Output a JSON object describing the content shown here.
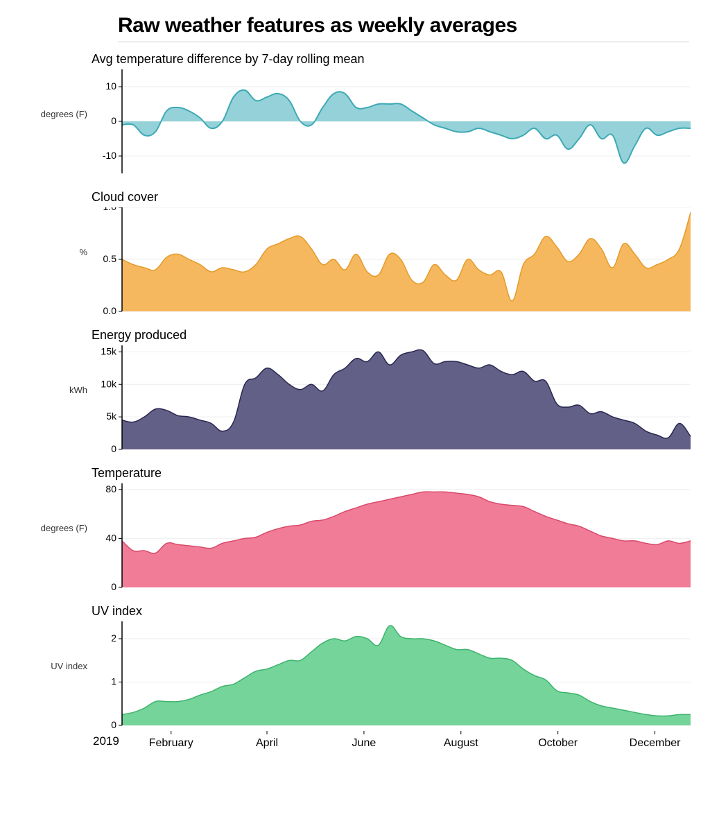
{
  "title": "Raw weather features as weekly averages",
  "x_start_label": "2019",
  "months": [
    "February",
    "April",
    "June",
    "August",
    "October",
    "December"
  ],
  "panels": [
    {
      "id": "tempdiff",
      "title": "Avg temperature difference by 7-day rolling mean",
      "ylabel": "degrees (F)",
      "ymin": -15,
      "ymax": 15,
      "yticks": [
        -10,
        0,
        10
      ],
      "baseline": 0,
      "fill": "#8ecfd6",
      "stroke": "#3da9b5",
      "stroke_w": 2
    },
    {
      "id": "cloud",
      "title": "Cloud cover",
      "ylabel": "%",
      "ymin": 0,
      "ymax": 1,
      "yticks": [
        0.0,
        0.5,
        1.0
      ],
      "tick_dec": 1,
      "baseline": 0,
      "fill": "#f5b455",
      "stroke": "#e59a2a",
      "stroke_w": 1.5
    },
    {
      "id": "energy",
      "title": "Energy produced",
      "ylabel": "kWh",
      "ymin": 0,
      "ymax": 16000,
      "yticks": [
        0,
        5000,
        10000,
        15000
      ],
      "tick_fmt": "k",
      "baseline": 0,
      "fill": "#5a577f",
      "stroke": "#2a2750",
      "stroke_w": 1.5
    },
    {
      "id": "temp",
      "title": "Temperature",
      "ylabel": "degrees (F)",
      "ymin": 0,
      "ymax": 85,
      "yticks": [
        0,
        40,
        80
      ],
      "baseline": 0,
      "fill": "#f07591",
      "stroke": "#d94a6b",
      "stroke_w": 1.5
    },
    {
      "id": "uv",
      "title": "UV index",
      "ylabel": "UV index",
      "ymin": 0,
      "ymax": 2.4,
      "yticks": [
        0,
        1,
        2
      ],
      "baseline": 0,
      "fill": "#6dd294",
      "stroke": "#3fb36e",
      "stroke_w": 1.5
    }
  ],
  "chart_data": [
    {
      "type": "area",
      "title": "Avg temperature difference by 7-day rolling mean",
      "ylabel": "degrees (F)",
      "ylim": [
        -15,
        15
      ],
      "x_weeks": [
        0,
        1,
        2,
        3,
        4,
        5,
        6,
        7,
        8,
        9,
        10,
        11,
        12,
        13,
        14,
        15,
        16,
        17,
        18,
        19,
        20,
        21,
        22,
        23,
        24,
        25,
        26,
        27,
        28,
        29,
        30,
        31,
        32,
        33,
        34,
        35,
        36,
        37,
        38,
        39,
        40,
        41,
        42,
        43,
        44,
        45,
        46,
        47,
        48,
        49,
        50,
        51
      ],
      "values": [
        -1,
        -1,
        -4,
        -3,
        3,
        4,
        3,
        1,
        -2,
        0,
        7,
        9,
        6,
        7,
        8,
        6,
        0,
        -1,
        4,
        8,
        8,
        4,
        4,
        5,
        5,
        5,
        3,
        1,
        -1,
        -2,
        -3,
        -3,
        -2,
        -3,
        -4,
        -5,
        -4,
        -2,
        -5,
        -4,
        -8,
        -5,
        -1,
        -5,
        -4,
        -12,
        -7,
        -2,
        -4,
        -3,
        -2,
        -2
      ]
    },
    {
      "type": "area",
      "title": "Cloud cover",
      "ylabel": "%",
      "ylim": [
        0,
        1
      ],
      "x_weeks": [
        0,
        1,
        2,
        3,
        4,
        5,
        6,
        7,
        8,
        9,
        10,
        11,
        12,
        13,
        14,
        15,
        16,
        17,
        18,
        19,
        20,
        21,
        22,
        23,
        24,
        25,
        26,
        27,
        28,
        29,
        30,
        31,
        32,
        33,
        34,
        35,
        36,
        37,
        38,
        39,
        40,
        41,
        42,
        43,
        44,
        45,
        46,
        47,
        48,
        49,
        50,
        51
      ],
      "values": [
        0.5,
        0.45,
        0.42,
        0.4,
        0.52,
        0.55,
        0.5,
        0.45,
        0.38,
        0.42,
        0.4,
        0.38,
        0.45,
        0.6,
        0.65,
        0.7,
        0.72,
        0.6,
        0.45,
        0.5,
        0.4,
        0.55,
        0.38,
        0.35,
        0.55,
        0.5,
        0.3,
        0.28,
        0.45,
        0.35,
        0.3,
        0.5,
        0.4,
        0.35,
        0.38,
        0.1,
        0.45,
        0.55,
        0.72,
        0.62,
        0.48,
        0.55,
        0.7,
        0.6,
        0.42,
        0.65,
        0.55,
        0.42,
        0.45,
        0.5,
        0.6,
        0.95
      ]
    },
    {
      "type": "area",
      "title": "Energy produced",
      "ylabel": "kWh",
      "ylim": [
        0,
        16000
      ],
      "x_weeks": [
        0,
        1,
        2,
        3,
        4,
        5,
        6,
        7,
        8,
        9,
        10,
        11,
        12,
        13,
        14,
        15,
        16,
        17,
        18,
        19,
        20,
        21,
        22,
        23,
        24,
        25,
        26,
        27,
        28,
        29,
        30,
        31,
        32,
        33,
        34,
        35,
        36,
        37,
        38,
        39,
        40,
        41,
        42,
        43,
        44,
        45,
        46,
        47,
        48,
        49,
        50,
        51
      ],
      "values": [
        4500,
        4200,
        5000,
        6200,
        6000,
        5200,
        5000,
        4500,
        4000,
        2800,
        4200,
        10000,
        11000,
        12500,
        11500,
        10000,
        9200,
        10000,
        9000,
        11500,
        12500,
        14000,
        13500,
        15000,
        13000,
        14500,
        15000,
        15200,
        13200,
        13500,
        13500,
        13000,
        12500,
        13000,
        12000,
        11500,
        12000,
        10500,
        10500,
        7000,
        6500,
        6800,
        5500,
        5800,
        5000,
        4500,
        4000,
        2800,
        2200,
        1800,
        4000,
        2000
      ]
    },
    {
      "type": "area",
      "title": "Temperature",
      "ylabel": "degrees (F)",
      "ylim": [
        0,
        85
      ],
      "x_weeks": [
        0,
        1,
        2,
        3,
        4,
        5,
        6,
        7,
        8,
        9,
        10,
        11,
        12,
        13,
        14,
        15,
        16,
        17,
        18,
        19,
        20,
        21,
        22,
        23,
        24,
        25,
        26,
        27,
        28,
        29,
        30,
        31,
        32,
        33,
        34,
        35,
        36,
        37,
        38,
        39,
        40,
        41,
        42,
        43,
        44,
        45,
        46,
        47,
        48,
        49,
        50,
        51
      ],
      "values": [
        38,
        30,
        30,
        28,
        36,
        35,
        34,
        33,
        32,
        36,
        38,
        40,
        41,
        45,
        48,
        50,
        51,
        54,
        55,
        58,
        62,
        65,
        68,
        70,
        72,
        74,
        76,
        78,
        78,
        78,
        77,
        76,
        74,
        70,
        68,
        67,
        66,
        62,
        58,
        55,
        52,
        50,
        46,
        42,
        40,
        38,
        38,
        36,
        35,
        38,
        36,
        38
      ]
    },
    {
      "type": "area",
      "title": "UV index",
      "ylabel": "UV index",
      "ylim": [
        0,
        2.4
      ],
      "x_weeks": [
        0,
        1,
        2,
        3,
        4,
        5,
        6,
        7,
        8,
        9,
        10,
        11,
        12,
        13,
        14,
        15,
        16,
        17,
        18,
        19,
        20,
        21,
        22,
        23,
        24,
        25,
        26,
        27,
        28,
        29,
        30,
        31,
        32,
        33,
        34,
        35,
        36,
        37,
        38,
        39,
        40,
        41,
        42,
        43,
        44,
        45,
        46,
        47,
        48,
        49,
        50,
        51
      ],
      "values": [
        0.25,
        0.3,
        0.4,
        0.55,
        0.55,
        0.55,
        0.6,
        0.7,
        0.78,
        0.9,
        0.95,
        1.1,
        1.25,
        1.3,
        1.4,
        1.5,
        1.5,
        1.7,
        1.9,
        2.0,
        1.95,
        2.05,
        2.0,
        1.85,
        2.3,
        2.05,
        2.0,
        2.0,
        1.95,
        1.85,
        1.75,
        1.75,
        1.65,
        1.55,
        1.55,
        1.5,
        1.3,
        1.15,
        1.05,
        0.8,
        0.75,
        0.7,
        0.55,
        0.45,
        0.4,
        0.35,
        0.3,
        0.25,
        0.22,
        0.22,
        0.25,
        0.25
      ]
    }
  ]
}
